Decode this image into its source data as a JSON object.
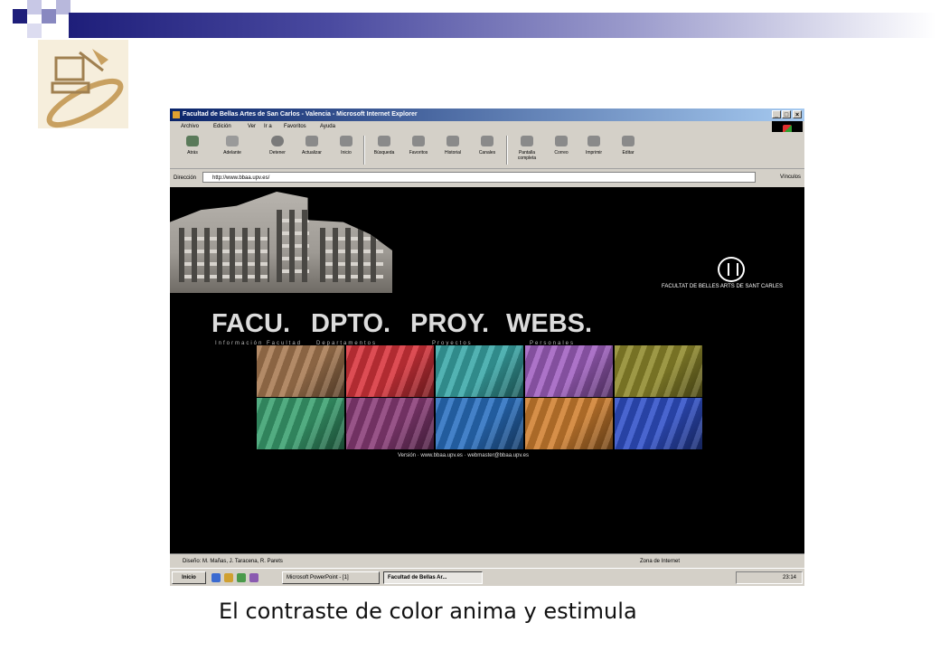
{
  "caption": "El contraste de color anima y estimula",
  "browser": {
    "title": "Facultad de Bellas Artes de San Carlos - Valencia - Microsoft Internet Explorer",
    "menu": [
      "Archivo",
      "Edición",
      "Ver",
      "Ir a",
      "Favoritos",
      "Ayuda"
    ],
    "toolbar": [
      "Atrás",
      "Adelante",
      "Detener",
      "Actualizar",
      "Inicio",
      "Búsqueda",
      "Favoritos",
      "Historial",
      "Canales",
      "Pantalla completa",
      "Correo",
      "Imprimir",
      "Editar"
    ],
    "address_label": "Dirección",
    "address": "http://www.bbaa.upv.es/",
    "links_label": "Vínculos",
    "status": "Diseño: M. Mañas, J. Taracena, R. Parets",
    "zone": "Zona de Internet"
  },
  "site": {
    "faculty": "FACULTAT DE BELLES ARTS DE SANT CARLES",
    "nav": [
      {
        "label": "FACU.",
        "sub": "Información Facultad"
      },
      {
        "label": "DPTO.",
        "sub": "Departamentos"
      },
      {
        "label": "PROY.",
        "sub": "Proyectos"
      },
      {
        "label": "WEBS.",
        "sub": "Personales"
      }
    ],
    "footer_links": "Versión  ·  www.bbaa.upv.es  ·  webmaster@bbaa.upv.es",
    "tiles": [
      "#a87a52",
      "#d8343c",
      "#3aa8a8",
      "#a060c0",
      "#908a2c",
      "#3aa070",
      "#8a3c78",
      "#2a70c0",
      "#d08030",
      "#3050c8"
    ]
  },
  "taskbar": {
    "start": "Inicio",
    "tasks": [
      "Microsoft PowerPoint - [1]",
      "Facultad de Bellas Ar..."
    ],
    "clock": "23:14"
  }
}
